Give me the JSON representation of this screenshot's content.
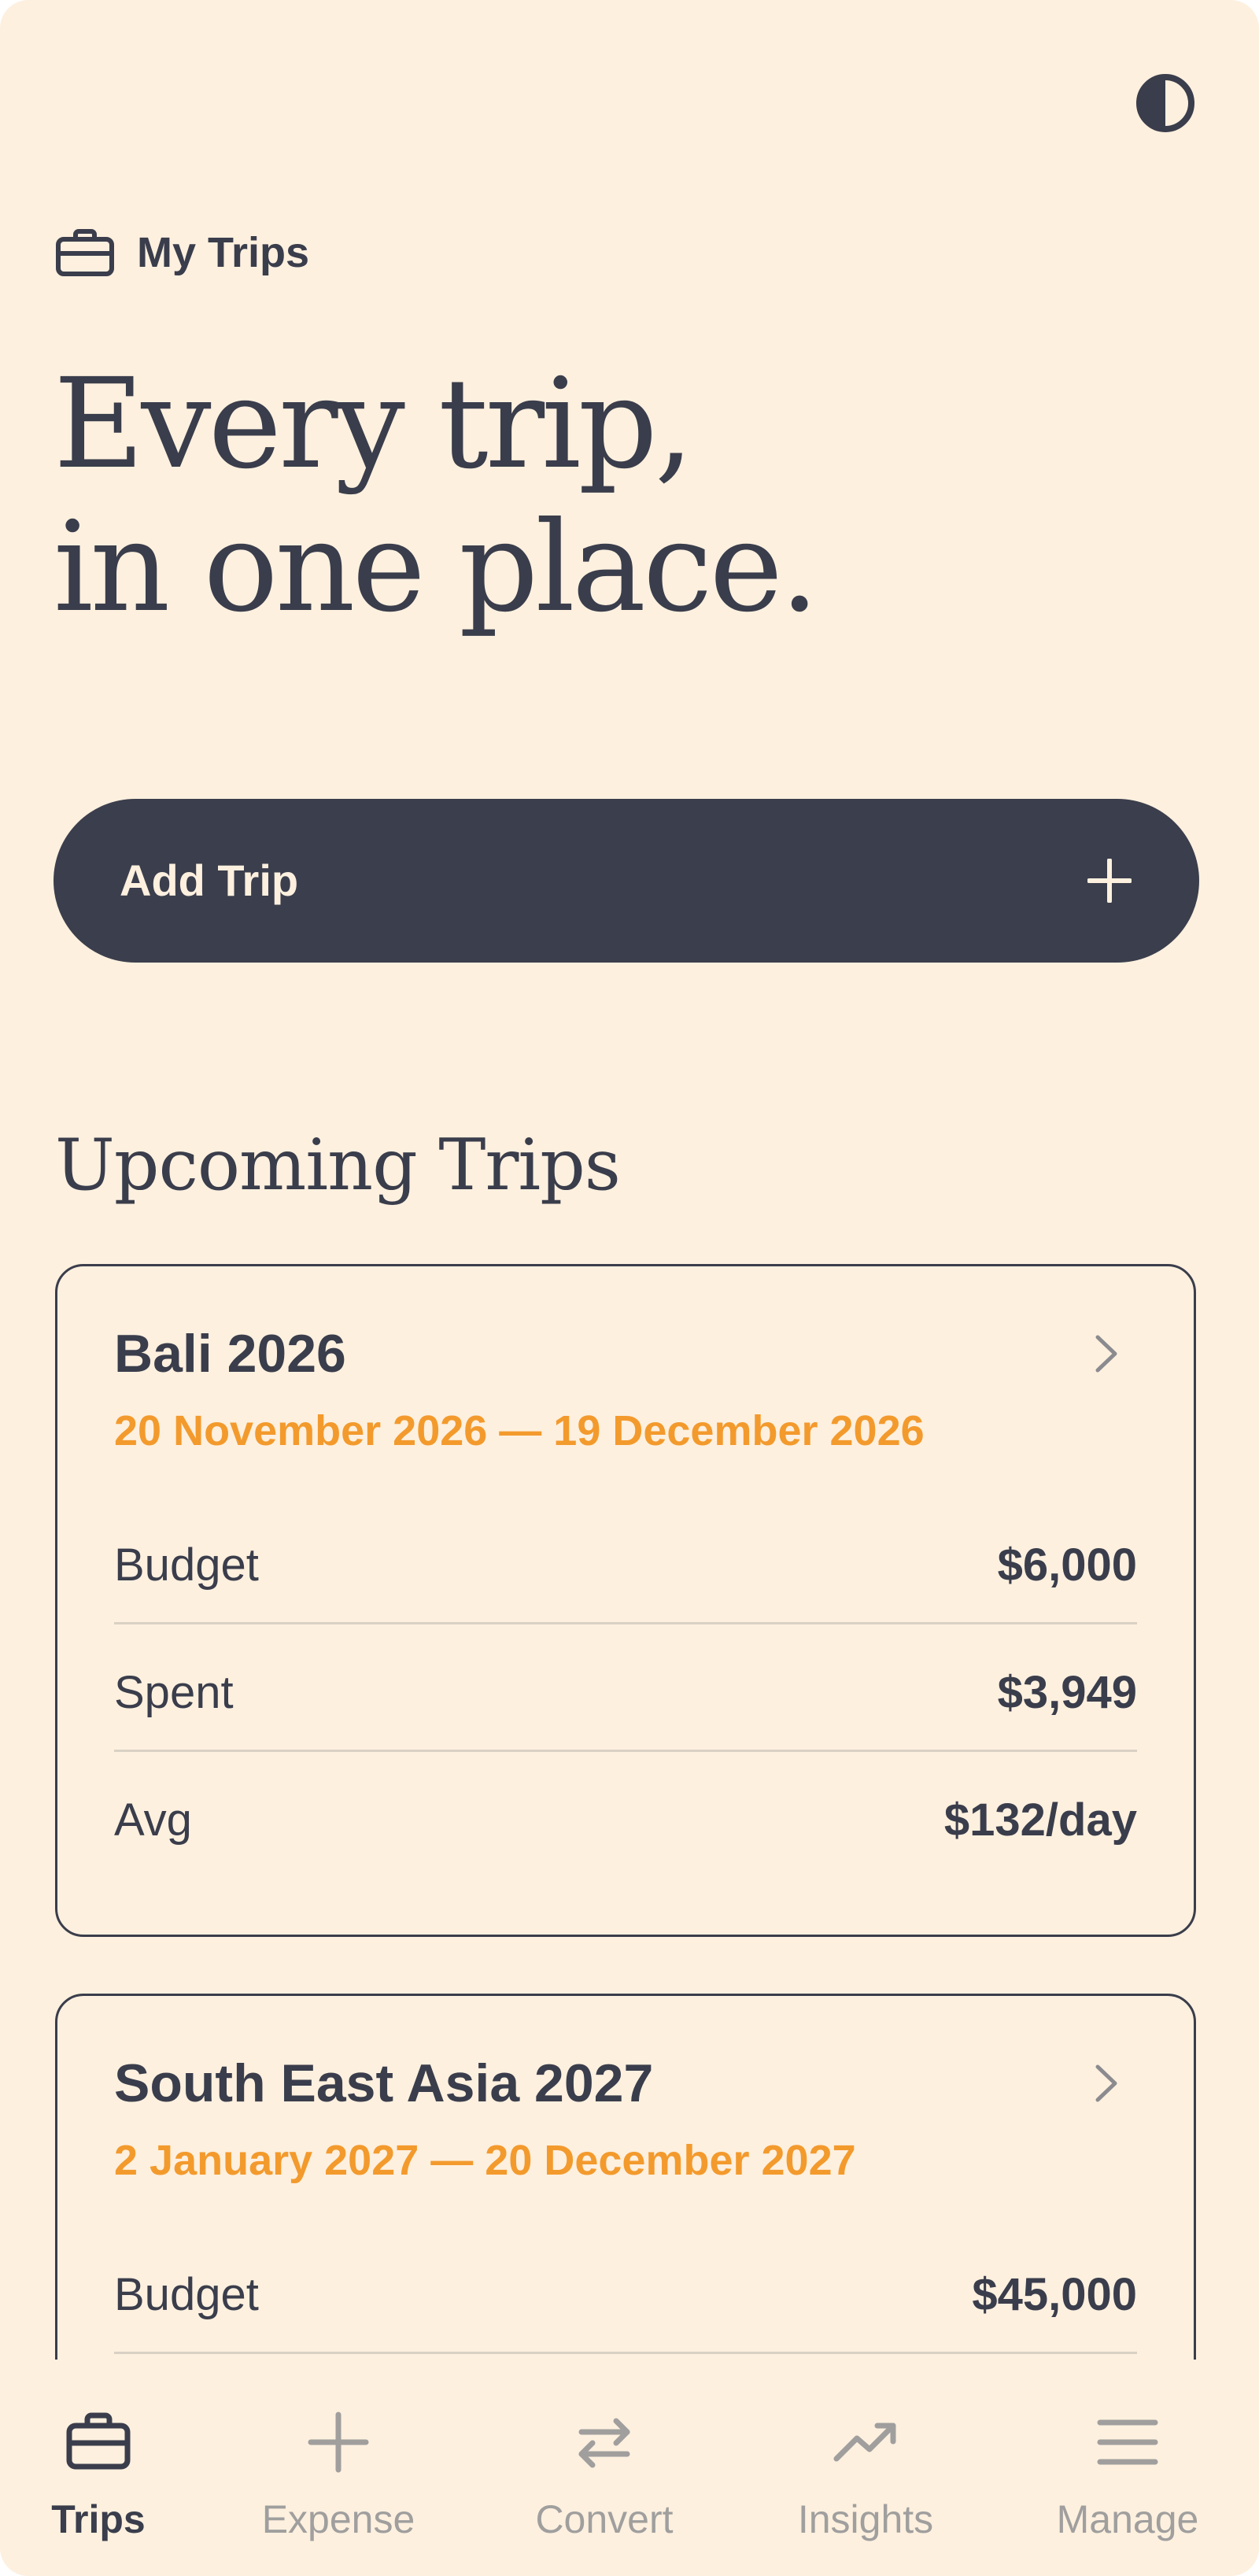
{
  "header": {
    "theme_toggle_icon": "contrast-icon",
    "eyebrow_icon": "briefcase-icon",
    "eyebrow_label": "My Trips",
    "headline_line1": "Every trip,",
    "headline_line2": "in one place."
  },
  "add_trip": {
    "label": "Add Trip",
    "icon": "plus-icon"
  },
  "upcoming": {
    "title": "Upcoming Trips",
    "trips": [
      {
        "name": "Bali 2026",
        "dates": "20 November 2026 — 19 December 2026",
        "rows": [
          {
            "label": "Budget",
            "value": "$6,000"
          },
          {
            "label": "Spent",
            "value": "$3,949"
          },
          {
            "label": "Avg",
            "value": "$132/day"
          }
        ]
      },
      {
        "name": "South East Asia 2027",
        "dates": "2 January 2027 — 20 December 2027",
        "rows": [
          {
            "label": "Budget",
            "value": "$45,000"
          }
        ]
      }
    ]
  },
  "tabbar": {
    "tabs": [
      {
        "label": "Trips",
        "icon": "briefcase-icon",
        "active": true
      },
      {
        "label": "Expense",
        "icon": "plus-icon",
        "active": false
      },
      {
        "label": "Convert",
        "icon": "swap-arrows-icon",
        "active": false
      },
      {
        "label": "Insights",
        "icon": "trend-up-icon",
        "active": false
      },
      {
        "label": "Manage",
        "icon": "menu-icon",
        "active": false
      }
    ]
  },
  "colors": {
    "background": "#fdf0df",
    "ink": "#3a3d4b",
    "accent": "#f39a2d",
    "inactive": "#a09f9e"
  }
}
